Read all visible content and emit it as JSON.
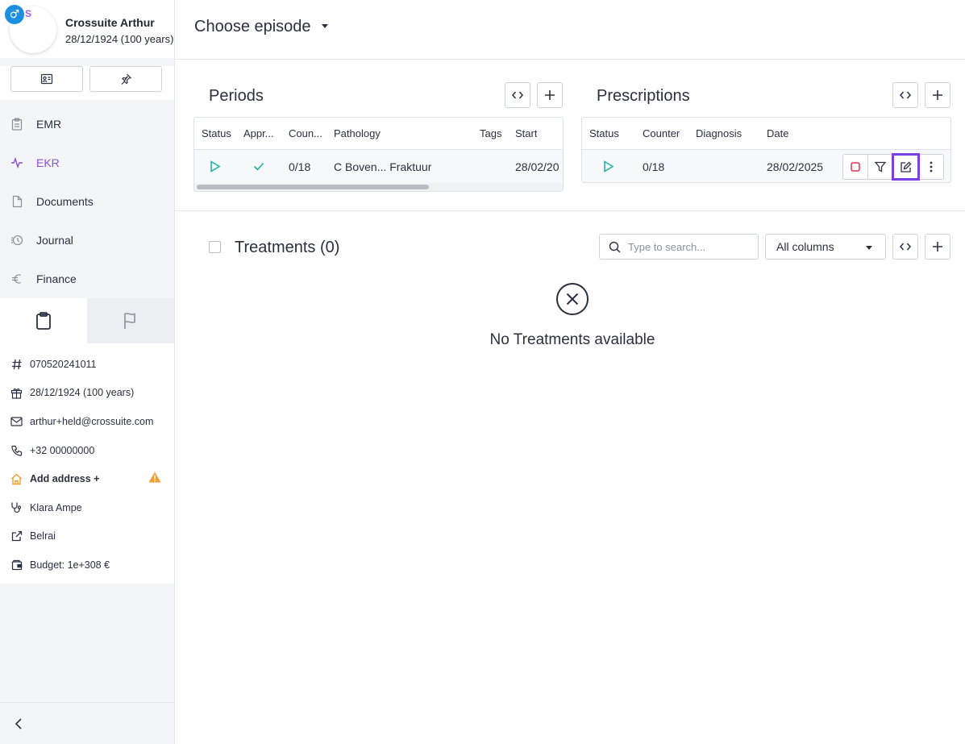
{
  "patient": {
    "gender_symbol": "♂",
    "initial": "S",
    "name": "Crossuite Arthur",
    "dob": "28/12/1924 (100 years)"
  },
  "nav": [
    {
      "label": "EMR",
      "icon": "clipboard-icon"
    },
    {
      "label": "EKR",
      "icon": "activity-icon"
    },
    {
      "label": "Documents",
      "icon": "document-icon"
    },
    {
      "label": "Journal",
      "icon": "history-icon"
    },
    {
      "label": "Finance",
      "icon": "euro-icon"
    }
  ],
  "info": {
    "id": "070520241011",
    "birthday": "28/12/1924 (100 years)",
    "email": "arthur+held@crossuite.com",
    "phone": "+32 00000000",
    "address": "Add address +",
    "doctor": "Klara Ampe",
    "referral": "Belrai",
    "budget": "Budget: 1e+308 €"
  },
  "header": {
    "episode_label": "Choose episode"
  },
  "periods": {
    "title": "Periods",
    "columns": [
      "Status",
      "Appr...",
      "Coun...",
      "Pathology",
      "Tags",
      "Start"
    ],
    "rows": [
      {
        "counter": "0/18",
        "pathology": "C Boven... Fraktuur",
        "tags": "",
        "start": "28/02/20"
      }
    ]
  },
  "prescriptions": {
    "title": "Prescriptions",
    "columns": [
      "Status",
      "Counter",
      "Diagnosis",
      "Date"
    ],
    "rows": [
      {
        "counter": "0/18",
        "diagnosis": "",
        "date": "28/02/2025"
      }
    ]
  },
  "treatments": {
    "title": "Treatments (0)",
    "search_placeholder": "Type to search...",
    "filter_value": "All columns",
    "empty_text": "No Treatments available"
  },
  "colors": {
    "accent": "#8a4fd6",
    "highlight": "#7b3fe4",
    "status_play": "#19b3a3",
    "stop": "#e5334d",
    "warning": "#f0a030",
    "gender_badge": "#1c8fe0"
  }
}
